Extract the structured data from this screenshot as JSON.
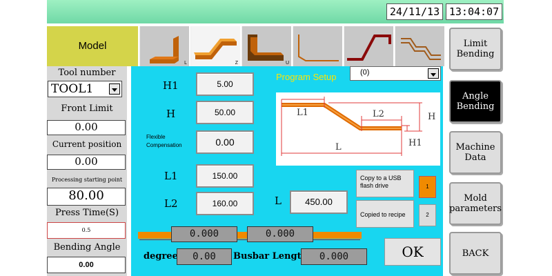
{
  "header": {
    "date": "24/11/13",
    "time": "13:04:07"
  },
  "model_label": "Model",
  "mold_tabs": [
    {
      "name": "L",
      "tag": "L"
    },
    {
      "name": "Z",
      "tag": "Z"
    },
    {
      "name": "U",
      "tag": "U"
    },
    {
      "name": "shape4",
      "tag": ""
    },
    {
      "name": "shape5",
      "tag": ""
    },
    {
      "name": "shape6",
      "tag": ""
    }
  ],
  "left_panel": {
    "tool_number_label": "Tool number",
    "tool_value": "TOOL1",
    "front_limit_label": "Front Limit",
    "front_limit_value": "0.00",
    "current_position_label": "Current position",
    "current_position_value": "0.00",
    "processing_start_label": "Processing starting point",
    "processing_start_value": "80.00",
    "press_time_label": "Press Time(S)",
    "press_time_value": "0.5",
    "bending_angle_label": "Bending Angle",
    "bending_angle_value": "0.00"
  },
  "program": {
    "title": "Program Setup",
    "selector_value": "(0)",
    "h1_label": "H1",
    "h1_value": "5.00",
    "h_label": "H",
    "h_value": "50.00",
    "flex_label_1": "Flexible",
    "flex_label_2": "Compensation",
    "flex_value": "0.00",
    "l1_label": "L1",
    "l1_value": "150.00",
    "l2_label": "L2",
    "l2_value": "160.00",
    "l_label": "L",
    "l_value": "450.00",
    "diagram": {
      "l1": "L1",
      "l2": "L2",
      "h": "H",
      "h1": "H1",
      "l": "L"
    },
    "copy_usb_label": "Copy to a USB flash drive",
    "copied_recipe_label": "Copied to recipe",
    "slot_1": "1",
    "slot_2": "2",
    "bar_value_1": "0.000",
    "bar_value_2": "0.000",
    "degree_label": "degree",
    "degree_value": "0.00",
    "busbar_label": "Busbar Length",
    "busbar_value": "0.000",
    "ok_label": "OK"
  },
  "right_nav": {
    "limit_bending": [
      "Limit",
      "Bending"
    ],
    "angle_bending": [
      "Angle",
      "Bending"
    ],
    "machine_data": [
      "Machine",
      "Data"
    ],
    "mold_parameters": [
      "Mold",
      "parameters"
    ],
    "back": "BACK"
  },
  "colors": {
    "accent_orange": "#f08a00",
    "cyan": "#18d6f0",
    "model_yellow": "#d4d44a"
  }
}
